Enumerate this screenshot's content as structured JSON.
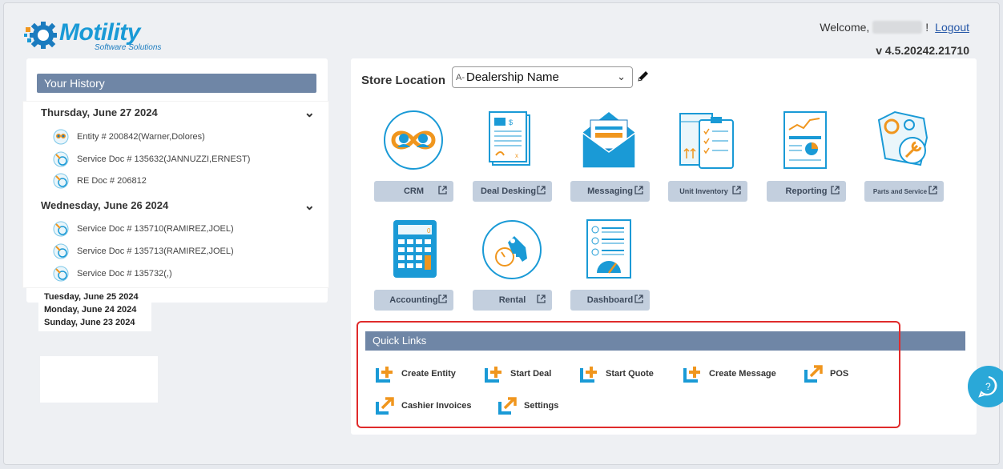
{
  "brand": {
    "name": "Motility",
    "subtitle": "Software Solutions"
  },
  "header": {
    "welcome_prefix": "Welcome,",
    "welcome_suffix": "!",
    "logout_label": "Logout",
    "version": "v 4.5.20242.21710"
  },
  "history": {
    "title": "Your History",
    "days": [
      {
        "label": "Thursday, June 27 2024",
        "items": [
          "Entity # 200842(Warner,Dolores)",
          "Service Doc # 135632(JANNUZZI,ERNEST)",
          "RE Doc # 206812"
        ]
      },
      {
        "label": "Wednesday, June 26 2024",
        "items": [
          "Service Doc # 135710(RAMIREZ,JOEL)",
          "Service Doc # 135713(RAMIREZ,JOEL)",
          "Service Doc # 135732(,)"
        ]
      }
    ],
    "collapsed_days": [
      "Tuesday, June 25 2024",
      "Monday, June 24 2024",
      "Sunday, June 23 2024"
    ]
  },
  "store": {
    "label": "Store Location",
    "prefix": "A-",
    "value": "Dealership Name"
  },
  "tiles": [
    {
      "label": "CRM",
      "icon": "crm-icon"
    },
    {
      "label": "Deal Desking",
      "icon": "deal-desking-icon"
    },
    {
      "label": "Messaging",
      "icon": "messaging-icon"
    },
    {
      "label": "Unit Inventory",
      "icon": "unit-inventory-icon"
    },
    {
      "label": "Reporting",
      "icon": "reporting-icon"
    },
    {
      "label": "Parts and Service",
      "icon": "parts-service-icon"
    },
    {
      "label": "Accounting",
      "icon": "calculator-icon"
    },
    {
      "label": "Rental",
      "icon": "key-icon"
    },
    {
      "label": "Dashboard",
      "icon": "dashboard-icon"
    }
  ],
  "quick_links": {
    "title": "Quick Links",
    "items": [
      "Create Entity",
      "Start Deal",
      "Start Quote",
      "Create Message",
      "POS",
      "Cashier Invoices",
      "Settings"
    ]
  },
  "colors": {
    "accent": "#1a9ad6",
    "orange": "#f0961e",
    "header_bar": "#6f86a6",
    "tile_button": "#c3cfde",
    "highlight": "#e02b2b"
  }
}
